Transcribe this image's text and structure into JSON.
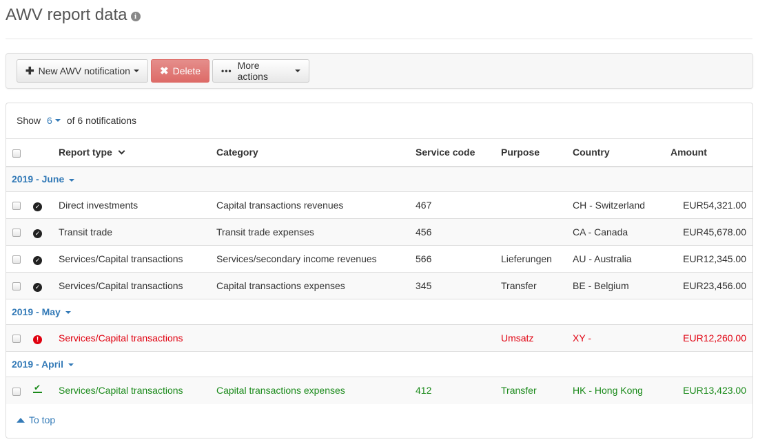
{
  "page": {
    "title": "AWV report data"
  },
  "toolbar": {
    "new_label": "New AWV notification",
    "delete_label": "Delete",
    "more_label": "More actions"
  },
  "pagination": {
    "show_label": "Show",
    "count": "6",
    "of_text": "of 6 notifications"
  },
  "table": {
    "headers": {
      "report_type": "Report type",
      "category": "Category",
      "service_code": "Service code",
      "purpose": "Purpose",
      "country": "Country",
      "amount": "Amount"
    },
    "groups": [
      {
        "label": "2019 - June",
        "rows": [
          {
            "status": "ok",
            "report_type": "Direct investments",
            "category": "Capital transactions revenues",
            "service_code": "467",
            "purpose": "",
            "country": "CH - Switzerland",
            "amount": "EUR54,321.00"
          },
          {
            "status": "ok",
            "report_type": "Transit trade",
            "category": "Transit trade expenses",
            "service_code": "456",
            "purpose": "",
            "country": "CA - Canada",
            "amount": "EUR45,678.00"
          },
          {
            "status": "ok",
            "report_type": "Services/Capital transactions",
            "category": "Services/secondary income revenues",
            "service_code": "566",
            "purpose": "Lieferungen",
            "country": "AU - Australia",
            "amount": "EUR12,345.00"
          },
          {
            "status": "ok",
            "report_type": "Services/Capital transactions",
            "category": "Capital transactions expenses",
            "service_code": "345",
            "purpose": "Transfer",
            "country": "BE - Belgium",
            "amount": "EUR23,456.00"
          }
        ]
      },
      {
        "label": "2019 - May",
        "rows": [
          {
            "status": "error",
            "report_type": "Services/Capital transactions",
            "category": "",
            "service_code": "",
            "purpose": "Umsatz",
            "country": "XY -",
            "amount": "EUR12,260.00"
          }
        ]
      },
      {
        "label": "2019 - April",
        "rows": [
          {
            "status": "submitted",
            "report_type": "Services/Capital transactions",
            "category": "Capital transactions expenses",
            "service_code": "412",
            "purpose": "Transfer",
            "country": "HK - Hong Kong",
            "amount": "EUR13,423.00"
          }
        ]
      }
    ]
  },
  "footer": {
    "to_top_label": "To top"
  },
  "colors": {
    "link": "#337ab7",
    "error": "#e0000f",
    "success": "#1a8a1a",
    "delete": "#d9534f"
  }
}
